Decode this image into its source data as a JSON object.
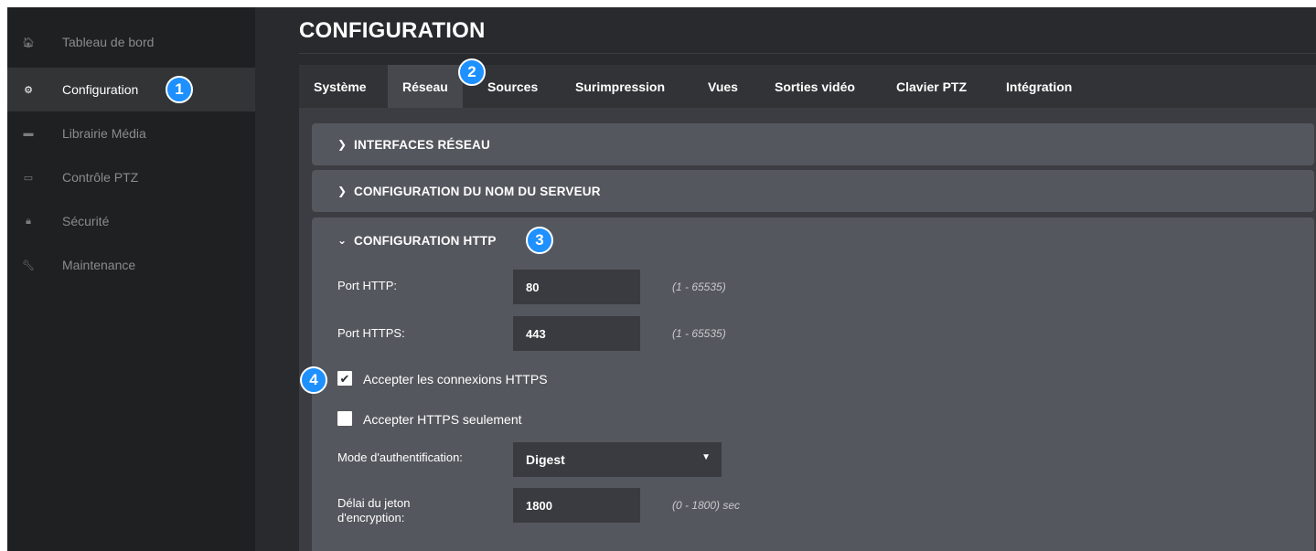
{
  "sidebar": {
    "items": [
      {
        "label": "Tableau de bord",
        "icon": "home-icon",
        "glyph": "🏠︎"
      },
      {
        "label": "Configuration",
        "icon": "gear-icon",
        "glyph": "⚙"
      },
      {
        "label": "Librairie Média",
        "icon": "folder-icon",
        "glyph": "▬"
      },
      {
        "label": "Contrôle PTZ",
        "icon": "camera-icon",
        "glyph": "▭"
      },
      {
        "label": "Sécurité",
        "icon": "lock-icon",
        "glyph": "🔒︎"
      },
      {
        "label": "Maintenance",
        "icon": "wrench-icon",
        "glyph": "🔧︎"
      }
    ]
  },
  "page": {
    "title": "CONFIGURATION"
  },
  "tabs": [
    "Système",
    "Réseau",
    "Sources",
    "Surimpression",
    "Vues",
    "Sorties vidéo",
    "Clavier PTZ",
    "Intégration"
  ],
  "panels": {
    "interfaces": {
      "title": "INTERFACES RÉSEAU"
    },
    "server_name": {
      "title": "CONFIGURATION DU NOM DU SERVEUR"
    },
    "http": {
      "title": "CONFIGURATION HTTP",
      "http_port": {
        "label": "Port HTTP:",
        "value": "80",
        "hint": "(1 - 65535)"
      },
      "https_port": {
        "label": "Port HTTPS:",
        "value": "443",
        "hint": "(1 - 65535)"
      },
      "accept_https": {
        "label": "Accepter les connexions HTTPS",
        "checked": true
      },
      "https_only": {
        "label": "Accepter HTTPS seulement",
        "checked": false
      },
      "auth_mode": {
        "label": "Mode d'authentification:",
        "value": "Digest"
      },
      "token_delay": {
        "label_line1": "Délai du jeton",
        "label_line2": "d'encryption:",
        "value": "1800",
        "hint": "(0 - 1800) sec"
      }
    }
  },
  "badges": [
    "1",
    "2",
    "3",
    "4"
  ],
  "colors": {
    "accent": "#1e90ff",
    "sidebar_bg": "#1f2021",
    "panel_bg": "#55575e"
  }
}
